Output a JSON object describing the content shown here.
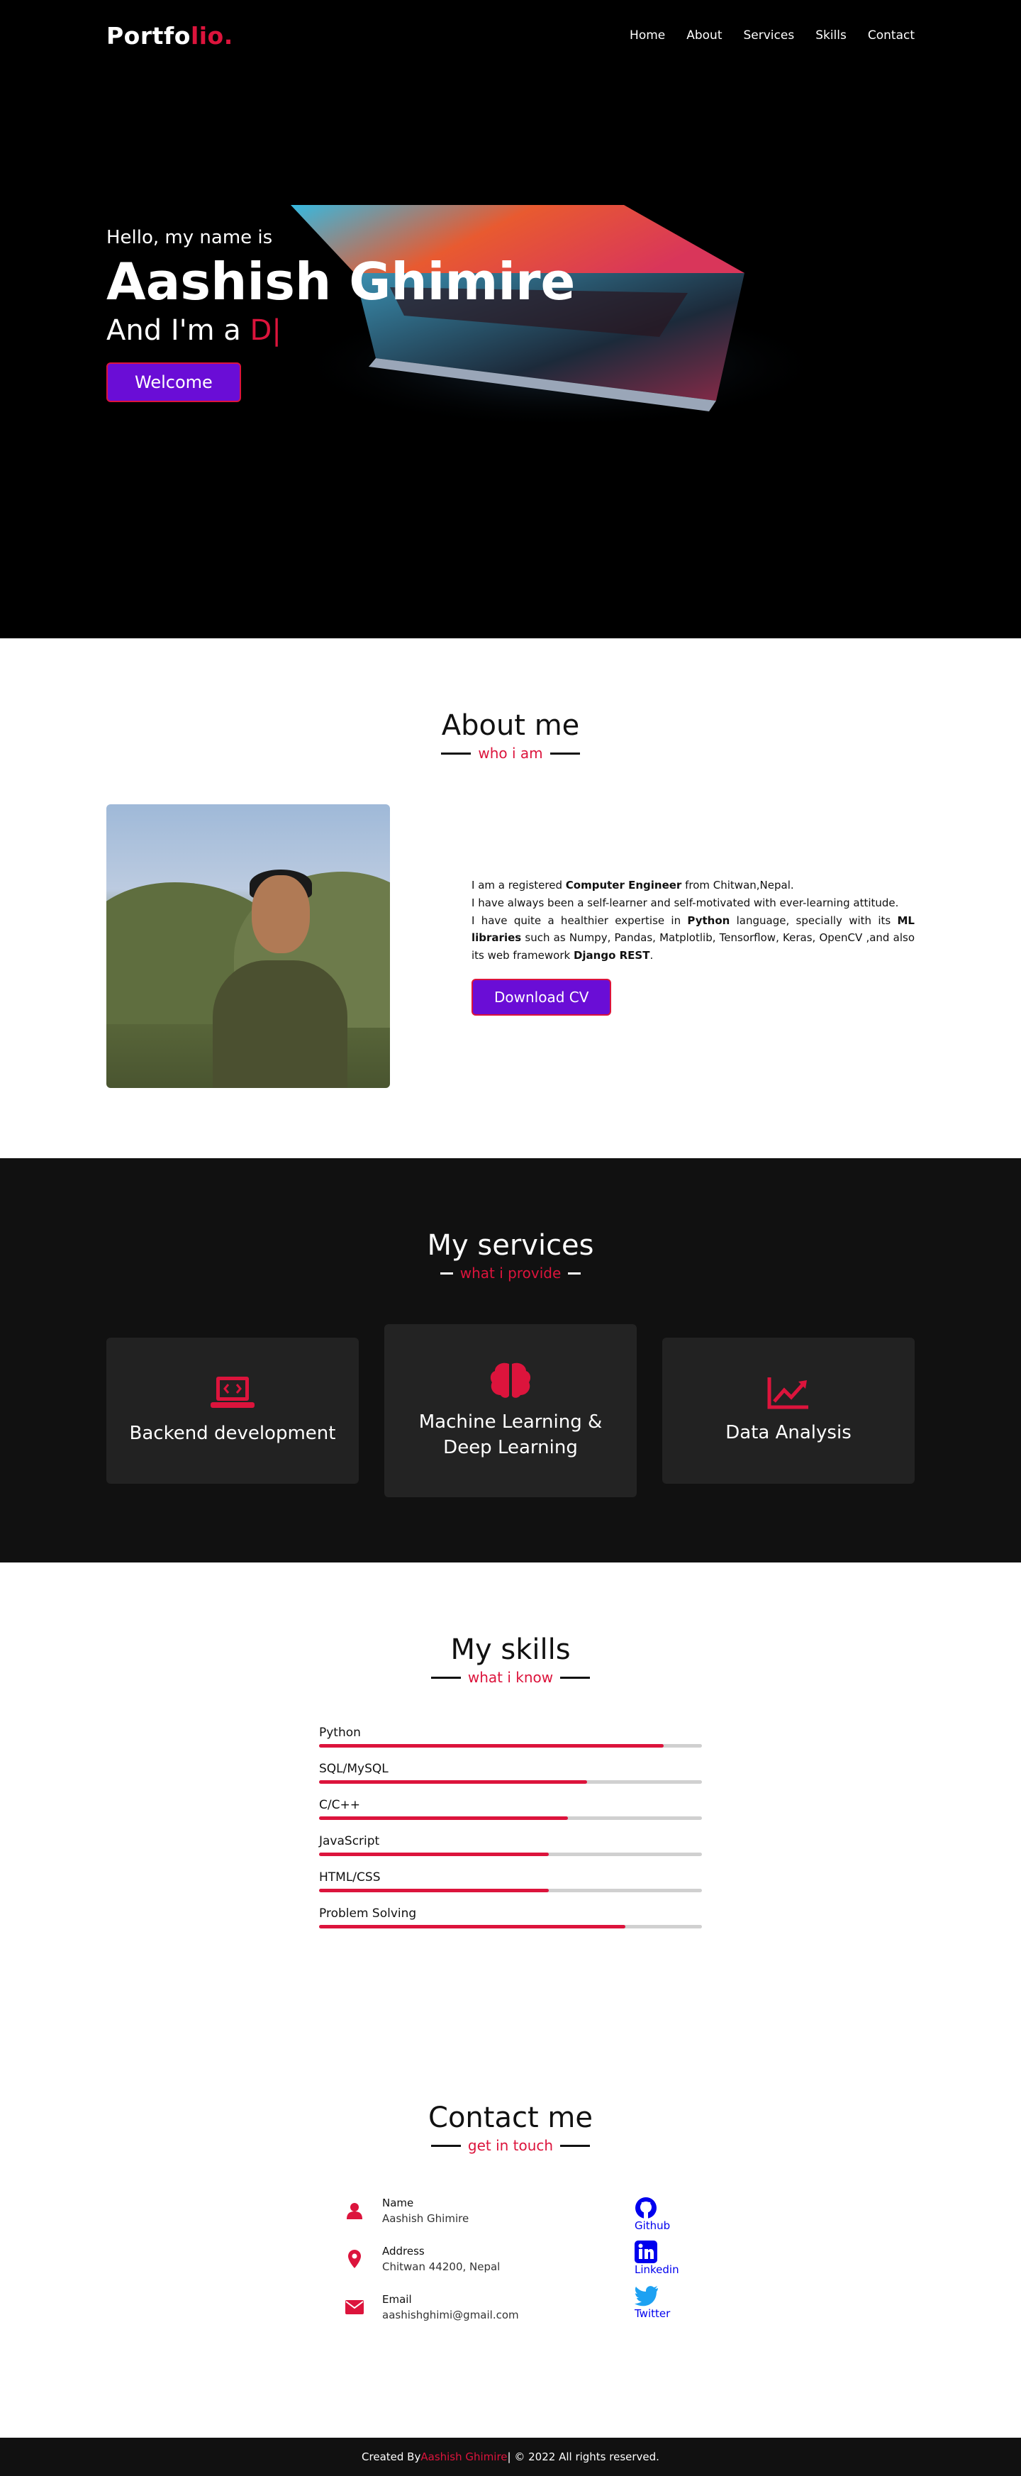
{
  "nav": {
    "logo_main": "Portfo",
    "logo_accent": "lio.",
    "items": [
      {
        "label": "Home"
      },
      {
        "label": "About"
      },
      {
        "label": "Services"
      },
      {
        "label": "Skills"
      },
      {
        "label": "Contact"
      }
    ]
  },
  "hero": {
    "greeting": "Hello, my name is",
    "name": "Aashish Ghimire",
    "role_prefix": "And I'm a ",
    "role_typed": "D|",
    "button": "Welcome"
  },
  "about": {
    "title": "About me",
    "subtitle": "who i am",
    "p1_a": "I am a registered ",
    "p1_b": "Computer Engineer",
    "p1_c": " from Chitwan,Nepal.",
    "p2": "I have always been a self-learner and self-motivated with ever-learning attitude.",
    "p3_a": "I have quite a healthier expertise in ",
    "p3_b": "Python",
    "p3_c": " language, specially with its ",
    "p3_d": "ML libraries",
    "p3_e": " such as Numpy, Pandas, Matplotlib, Tensorflow, Keras, OpenCV ,and also its web framework ",
    "p3_f": "Django REST",
    "p3_g": ".",
    "button": "Download CV"
  },
  "services": {
    "title": "My services",
    "subtitle": "what i provide",
    "cards": [
      {
        "title": "Backend development",
        "icon": "laptop-code-icon"
      },
      {
        "title": "Machine Learning & Deep Learning",
        "icon": "brain-icon"
      },
      {
        "title": "Data Analysis",
        "icon": "chart-line-icon"
      }
    ]
  },
  "skills": {
    "title": "My skills",
    "subtitle": "what i know",
    "items": [
      {
        "name": "Python",
        "level": 0.9
      },
      {
        "name": "SQL/MySQL",
        "level": 0.7
      },
      {
        "name": "C/C++",
        "level": 0.65
      },
      {
        "name": "JavaScript",
        "level": 0.6
      },
      {
        "name": "HTML/CSS",
        "level": 0.6
      },
      {
        "name": "Problem Solving",
        "level": 0.8
      }
    ]
  },
  "contact": {
    "title": "Contact me",
    "subtitle": "get in touch",
    "rows": [
      {
        "label": "Name",
        "value": "Aashish Ghimire",
        "icon": "user-icon"
      },
      {
        "label": "Address",
        "value": "Chitwan 44200, Nepal",
        "icon": "map-marker-icon"
      },
      {
        "label": "Email",
        "value": "aashishghimi@gmail.com",
        "icon": "envelope-icon"
      }
    ],
    "social": [
      {
        "label": "Github",
        "icon": "github-icon"
      },
      {
        "label": "Linkedin",
        "icon": "linkedin-icon"
      },
      {
        "label": "Twitter",
        "icon": "twitter-icon"
      }
    ]
  },
  "footer": {
    "prefix": "Created By ",
    "author": "Aashish Ghimire",
    "suffix": " | © 2022 All rights reserved."
  },
  "colors": {
    "accent": "#dc143c",
    "button": "#6a0dd6",
    "dark": "#111111",
    "card": "#222222"
  }
}
